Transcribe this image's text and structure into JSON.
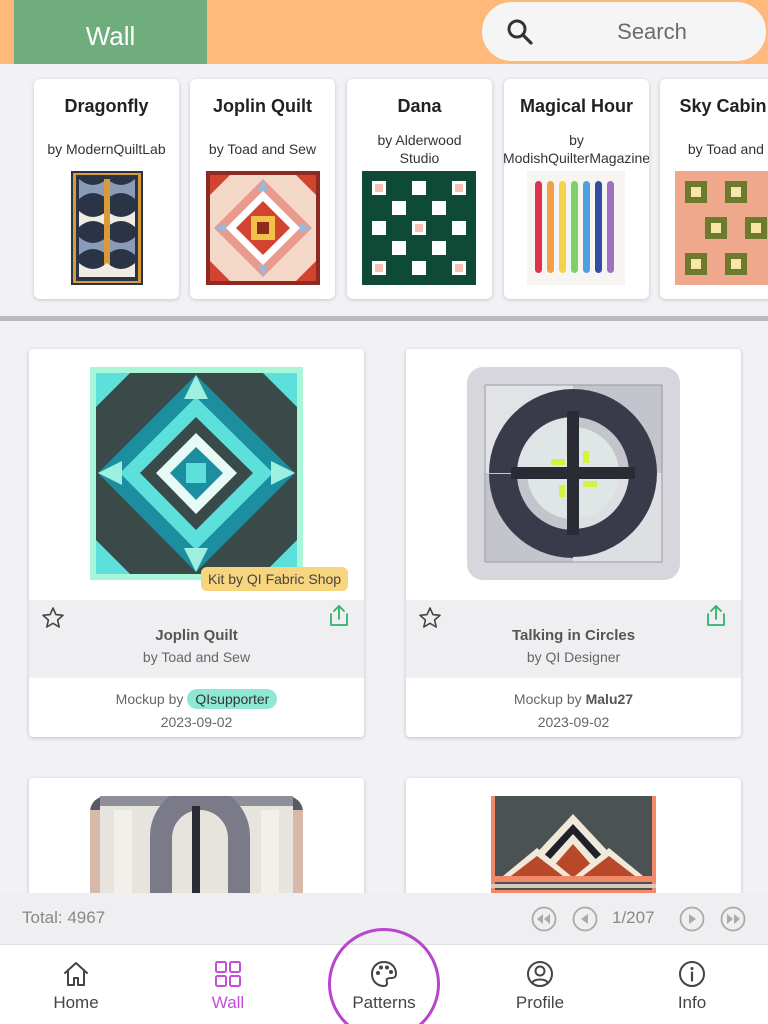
{
  "header": {
    "tab_label": "Wall",
    "search_placeholder": "Search"
  },
  "featured": [
    {
      "title": "Dragonfly",
      "author": "by ModernQuiltLab",
      "icon": "quilt-thumbnail"
    },
    {
      "title": "Joplin Quilt",
      "author": "by Toad and Sew",
      "icon": "quilt-thumbnail"
    },
    {
      "title": "Dana",
      "author": "by Alderwood\nStudio",
      "icon": "quilt-thumbnail"
    },
    {
      "title": "Magical Hour",
      "author": "by\nModishQuilterMagazine",
      "icon": "quilt-thumbnail"
    },
    {
      "title": "Sky Cabin Q",
      "author": "by Toad and S",
      "icon": "quilt-thumbnail"
    }
  ],
  "cards": [
    {
      "title": "Joplin Quilt",
      "author": "by Toad and Sew",
      "kit_badge": "Kit by QI Fabric Shop",
      "mockup_prefix": "Mockup by",
      "mockup_user": "QIsupporter",
      "date": "2023-09-02"
    },
    {
      "title": "Talking in Circles",
      "author": "by QI Designer",
      "mockup_prefix": "Mockup by",
      "mockup_user": "Malu27",
      "date": "2023-09-02"
    }
  ],
  "pagination": {
    "total": "Total: 4967",
    "page": "1/207"
  },
  "nav": [
    {
      "label": "Home",
      "icon": "home-icon"
    },
    {
      "label": "Wall",
      "icon": "grid-icon",
      "active": true
    },
    {
      "label": "Patterns",
      "icon": "palette-icon"
    },
    {
      "label": "Profile",
      "icon": "profile-icon"
    },
    {
      "label": "Info",
      "icon": "info-icon"
    }
  ],
  "colors": {
    "header": "#ffb97a",
    "wall_tab": "#6fae7c",
    "active_nav": "#c24fd6",
    "share_icon": "#2fb36a",
    "kit_badge": "#f7d47e",
    "mockup_pill": "#8fe8d6"
  }
}
